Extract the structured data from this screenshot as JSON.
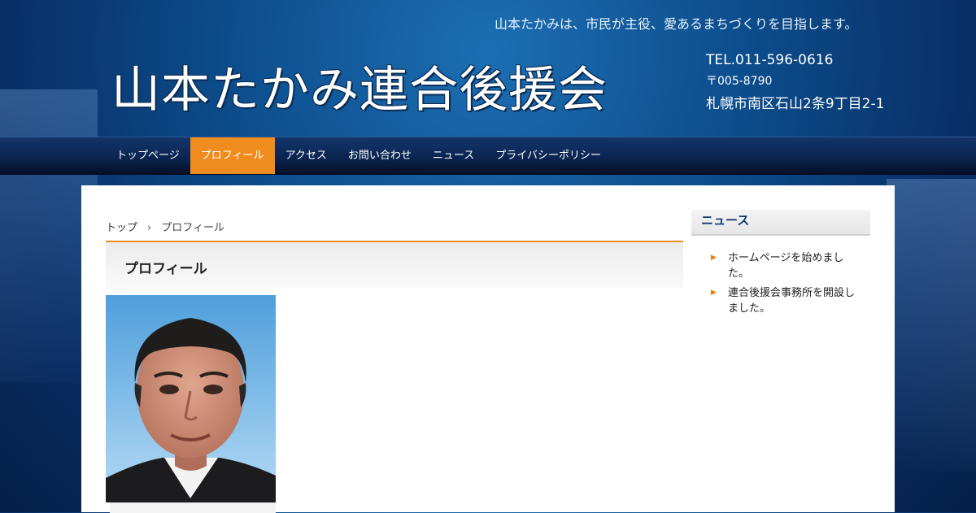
{
  "header": {
    "tagline": "山本たかみは、市民が主役、愛あるまちづくりを目指します。",
    "site_title": "山本たかみ連合後援会",
    "tel": "TEL.011-596-0616",
    "zip": "〒005-8790",
    "address": "札幌市南区石山2条9丁目2-1"
  },
  "nav": {
    "items": [
      {
        "label": "トップページ"
      },
      {
        "label": "プロフィール"
      },
      {
        "label": "アクセス"
      },
      {
        "label": "お問い合わせ"
      },
      {
        "label": "ニュース"
      },
      {
        "label": "プライバシーポリシー"
      }
    ],
    "active_index": 1
  },
  "breadcrumb": {
    "home": "トップ",
    "separator": "›",
    "current": "プロフィール"
  },
  "main": {
    "title": "プロフィール"
  },
  "sidebar": {
    "title": "ニュース",
    "news": [
      {
        "text": "ホームページを始めました。"
      },
      {
        "text": "連合後援会事務所を開設しました。"
      }
    ]
  },
  "colors": {
    "accent": "#f08c1e",
    "nav_bg": "#0b2552",
    "sidebar_title": "#123a70"
  }
}
